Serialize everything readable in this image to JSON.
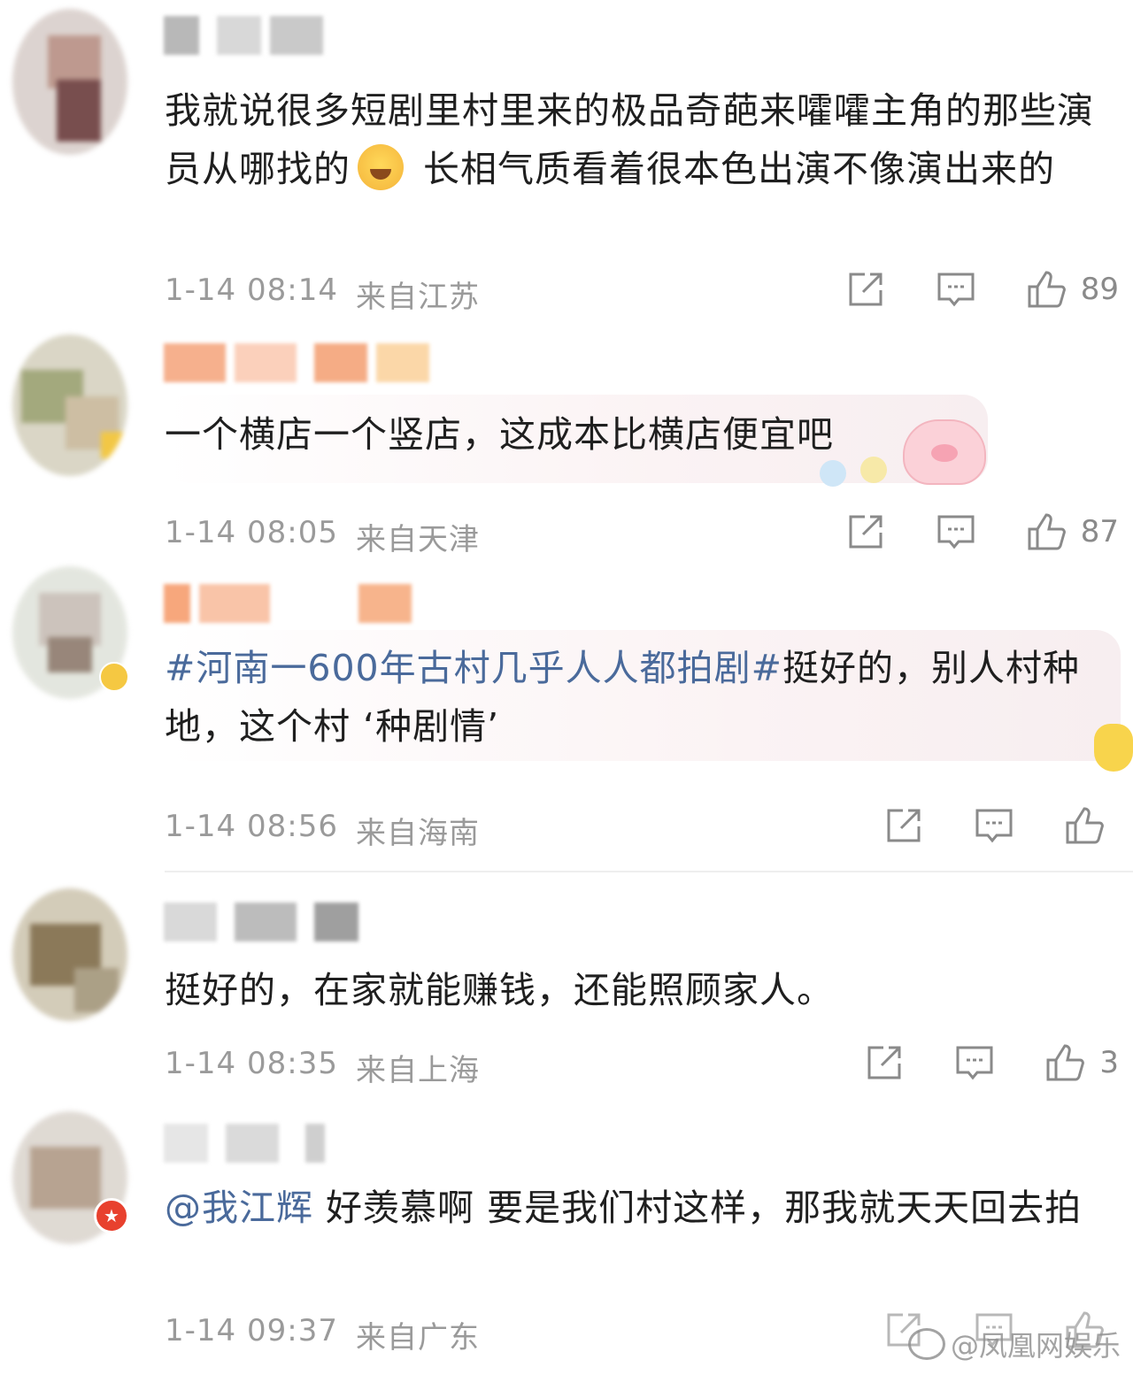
{
  "comments": [
    {
      "text_before_emoji": "我就说很多短剧里村里来的极品奇葩来嚯嚯主角的那些演员从哪找的",
      "emoji": "laugh-cry-emoji",
      "text_after_emoji": " 长相气质看着很本色出演不像演出来的",
      "date": "1-14 08:14",
      "location": "来自江苏",
      "likes": "89"
    },
    {
      "text": "一个横店一个竖店，这成本比横店便宜吧",
      "date": "1-14 08:05",
      "location": "来自天津",
      "likes": "87"
    },
    {
      "topic": "#河南一600年古村几乎人人都拍剧#",
      "text": "挺好的，别人村种地，这个村 ‘种剧情’",
      "date": "1-14 08:56",
      "location": "来自海南",
      "likes": ""
    },
    {
      "text": "挺好的，在家就能赚钱，还能照顾家人。",
      "date": "1-14 08:35",
      "location": "来自上海",
      "likes": "3"
    },
    {
      "mention": "@我江辉",
      "text": " 好羡慕啊 要是我们村这样，那我就天天回去拍",
      "date": "1-14 09:37",
      "location": "来自广东",
      "likes": ""
    }
  ],
  "watermark": "@凤凰网娱乐",
  "colors": {
    "link": "#4a6a9b",
    "meta": "#9a9a9a",
    "text": "#1f1f1f"
  }
}
